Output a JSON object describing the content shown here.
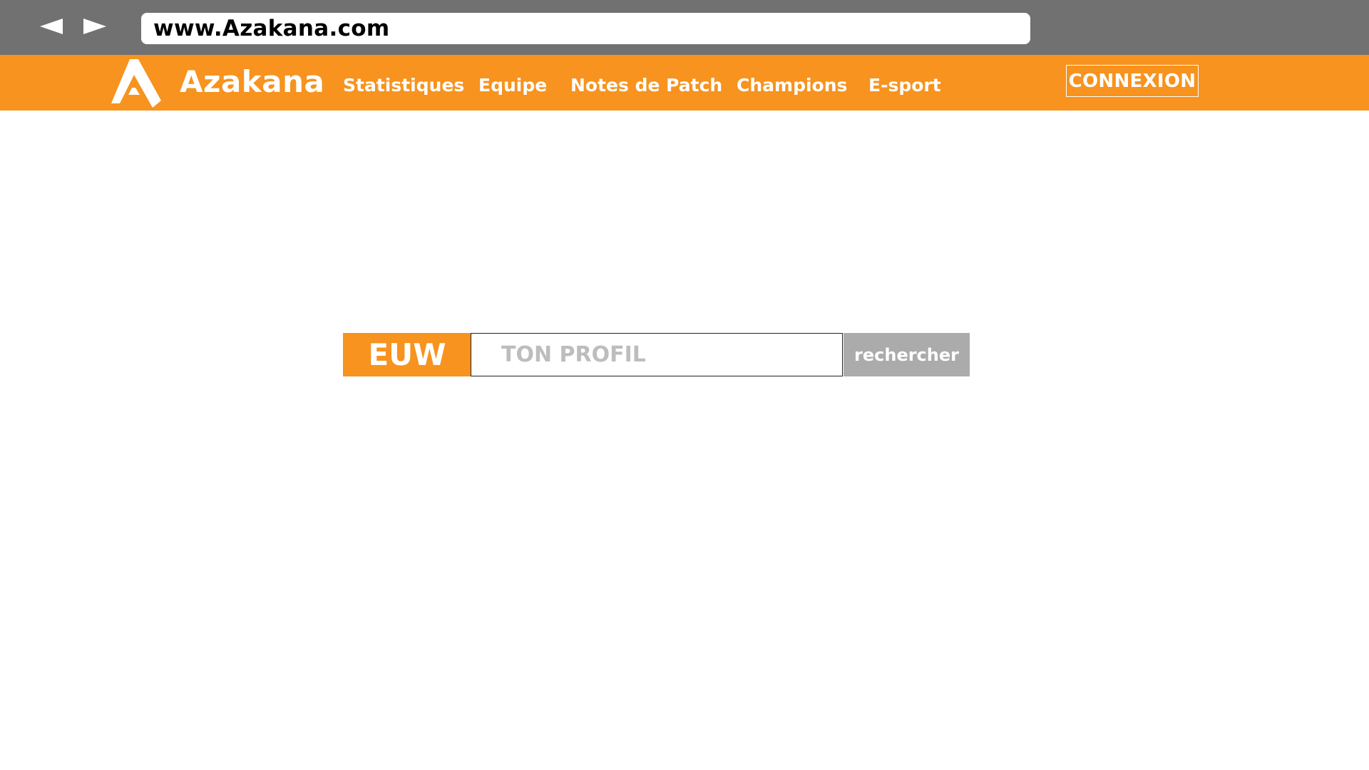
{
  "browser": {
    "back_icon": "triangle-left-icon",
    "forward_icon": "triangle-right-icon",
    "url": "www.Azakana.com"
  },
  "header": {
    "logo_icon": "azakana-logo-icon",
    "brand": "Azakana",
    "nav": [
      {
        "label": "Statistiques"
      },
      {
        "label": "Equipe"
      },
      {
        "label": "Notes de Patch"
      },
      {
        "label": "Champions"
      },
      {
        "label": "E-sport"
      }
    ],
    "login_label": "CONNEXION"
  },
  "search": {
    "region": "EUW",
    "placeholder": "TON PROFIL",
    "button_label": "rechercher"
  },
  "colors": {
    "chrome": "#717171",
    "accent": "#f7931e",
    "button_gray": "#ababab",
    "placeholder_gray": "#bdbdbd"
  }
}
